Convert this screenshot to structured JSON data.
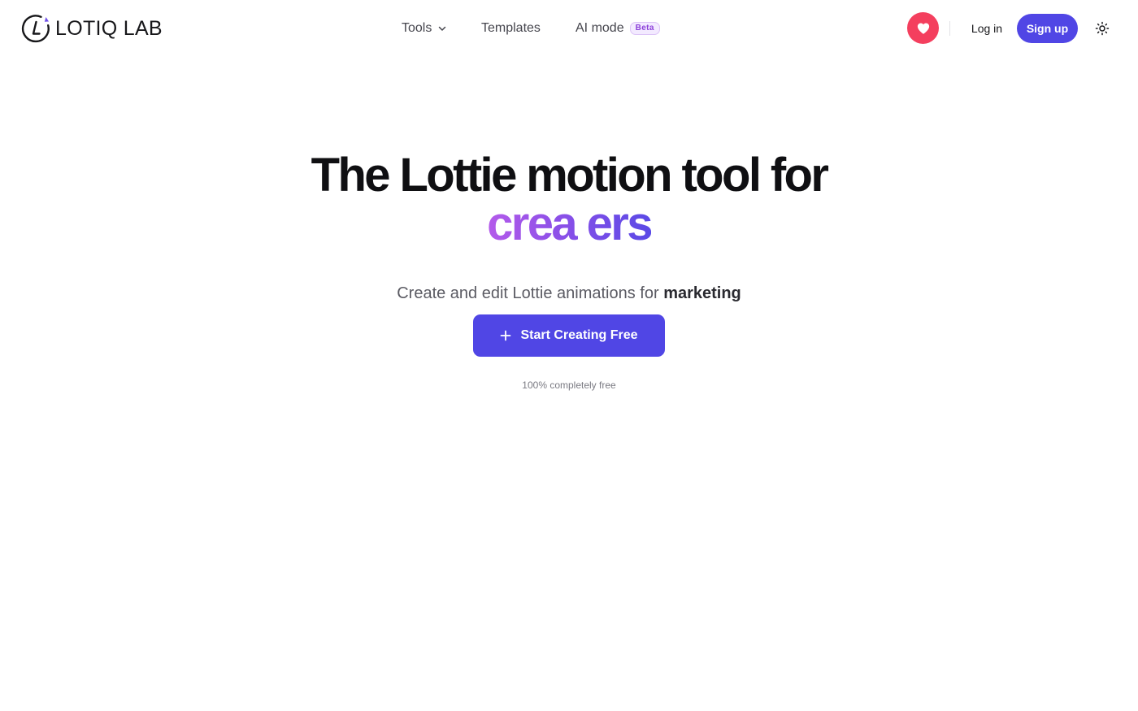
{
  "header": {
    "logo_text": "LOTIQ LAB",
    "nav": {
      "tools_label": "Tools",
      "templates_label": "Templates",
      "ai_mode_label": "AI mode",
      "ai_mode_badge": "Beta"
    },
    "heart_icon": "heart-icon",
    "login_label": "Log in",
    "signup_label": "Sign up",
    "theme_icon": "sun-icon"
  },
  "hero": {
    "title_line1": "The Lottie motion tool for",
    "title_line2": "crea ers",
    "subtitle_prefix": "Create and edit Lottie animations for ",
    "subtitle_highlight": "marketing",
    "cta_label": "Start Creating Free",
    "note": "100% completely free"
  },
  "colors": {
    "accent": "#5046e5",
    "heart": "#f43f5e",
    "gradient_start": "#b45bea",
    "gradient_end": "#5a4ae6",
    "beta_text": "#8b3fd9"
  }
}
